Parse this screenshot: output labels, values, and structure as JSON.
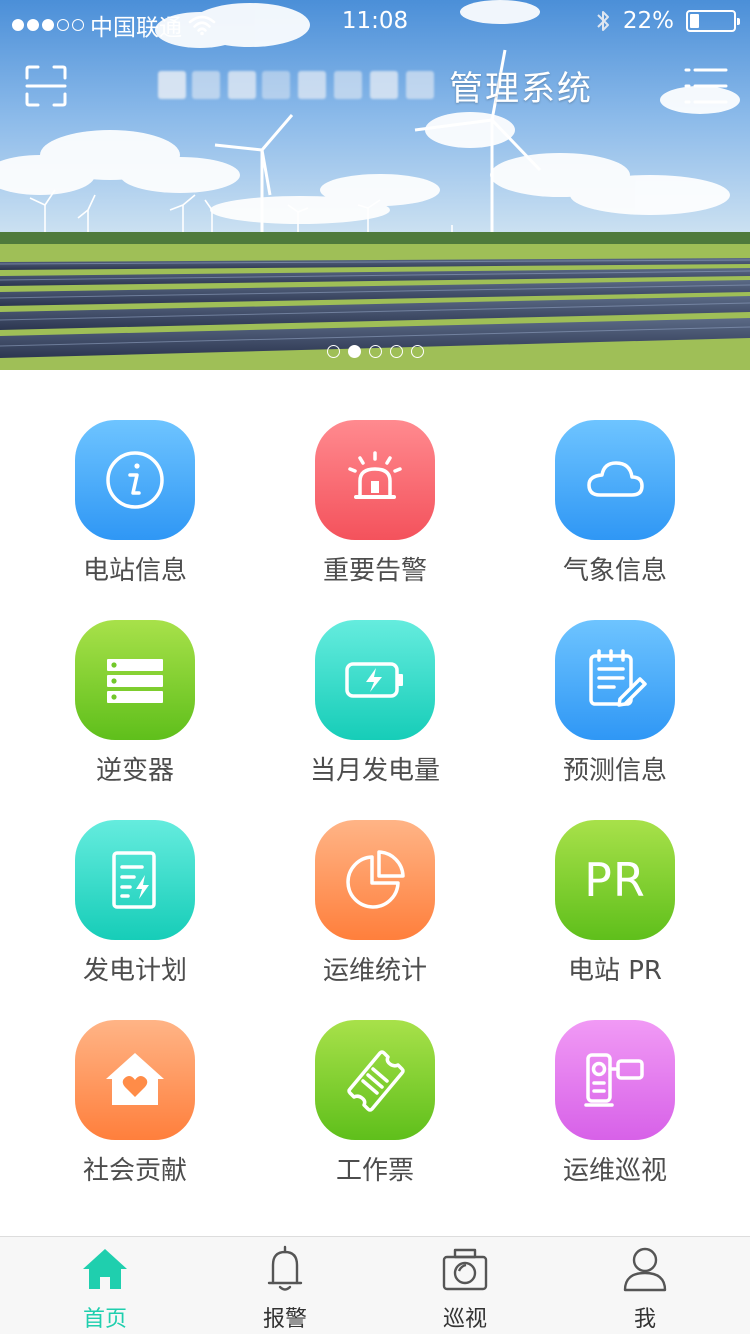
{
  "status_bar": {
    "carrier": "中国联通",
    "signal_bars_filled": 3,
    "signal_bars_total": 5,
    "time": "11:08",
    "battery_percent": "22%",
    "battery_level": 0.22
  },
  "header": {
    "title": "管理系统",
    "scan_icon": "scan-icon",
    "menu_icon": "menu-icon"
  },
  "banner": {
    "slide_count": 5,
    "active_slide": 2
  },
  "grid": {
    "items": [
      {
        "label": "电站信息",
        "icon": "info-icon",
        "color": "#3ba6f7"
      },
      {
        "label": "重要告警",
        "icon": "alarm-siren-icon",
        "color": "#f76068"
      },
      {
        "label": "气象信息",
        "icon": "cloud-icon",
        "color": "#3ba6f7"
      },
      {
        "label": "逆变器",
        "icon": "server-rack-icon",
        "color": "#72c82a"
      },
      {
        "label": "当月发电量",
        "icon": "battery-charge-icon",
        "color": "#27d3c0"
      },
      {
        "label": "预测信息",
        "icon": "notepad-edit-icon",
        "color": "#3ba6f7"
      },
      {
        "label": "发电计划",
        "icon": "power-plan-document-icon",
        "color": "#27d3c0"
      },
      {
        "label": "运维统计",
        "icon": "pie-chart-icon",
        "color": "#ff8c48"
      },
      {
        "label": "电站 PR",
        "icon_text": "PR",
        "icon": "pr-text-icon",
        "color": "#72c82a"
      },
      {
        "label": "社会贡献",
        "icon": "heart-house-icon",
        "color": "#ff8c48"
      },
      {
        "label": "工作票",
        "icon": "ticket-icon",
        "color": "#72c82a"
      },
      {
        "label": "运维巡视",
        "icon": "video-camera-icon",
        "color": "#dc6bea"
      }
    ]
  },
  "tabbar": {
    "accent": "#1fcfae",
    "tabs": [
      {
        "label": "首页",
        "icon": "home-icon",
        "active": true
      },
      {
        "label": "报警",
        "icon": "bell-icon",
        "active": false
      },
      {
        "label": "巡视",
        "icon": "camera-icon",
        "active": false
      },
      {
        "label": "我",
        "icon": "user-icon",
        "active": false
      }
    ]
  }
}
